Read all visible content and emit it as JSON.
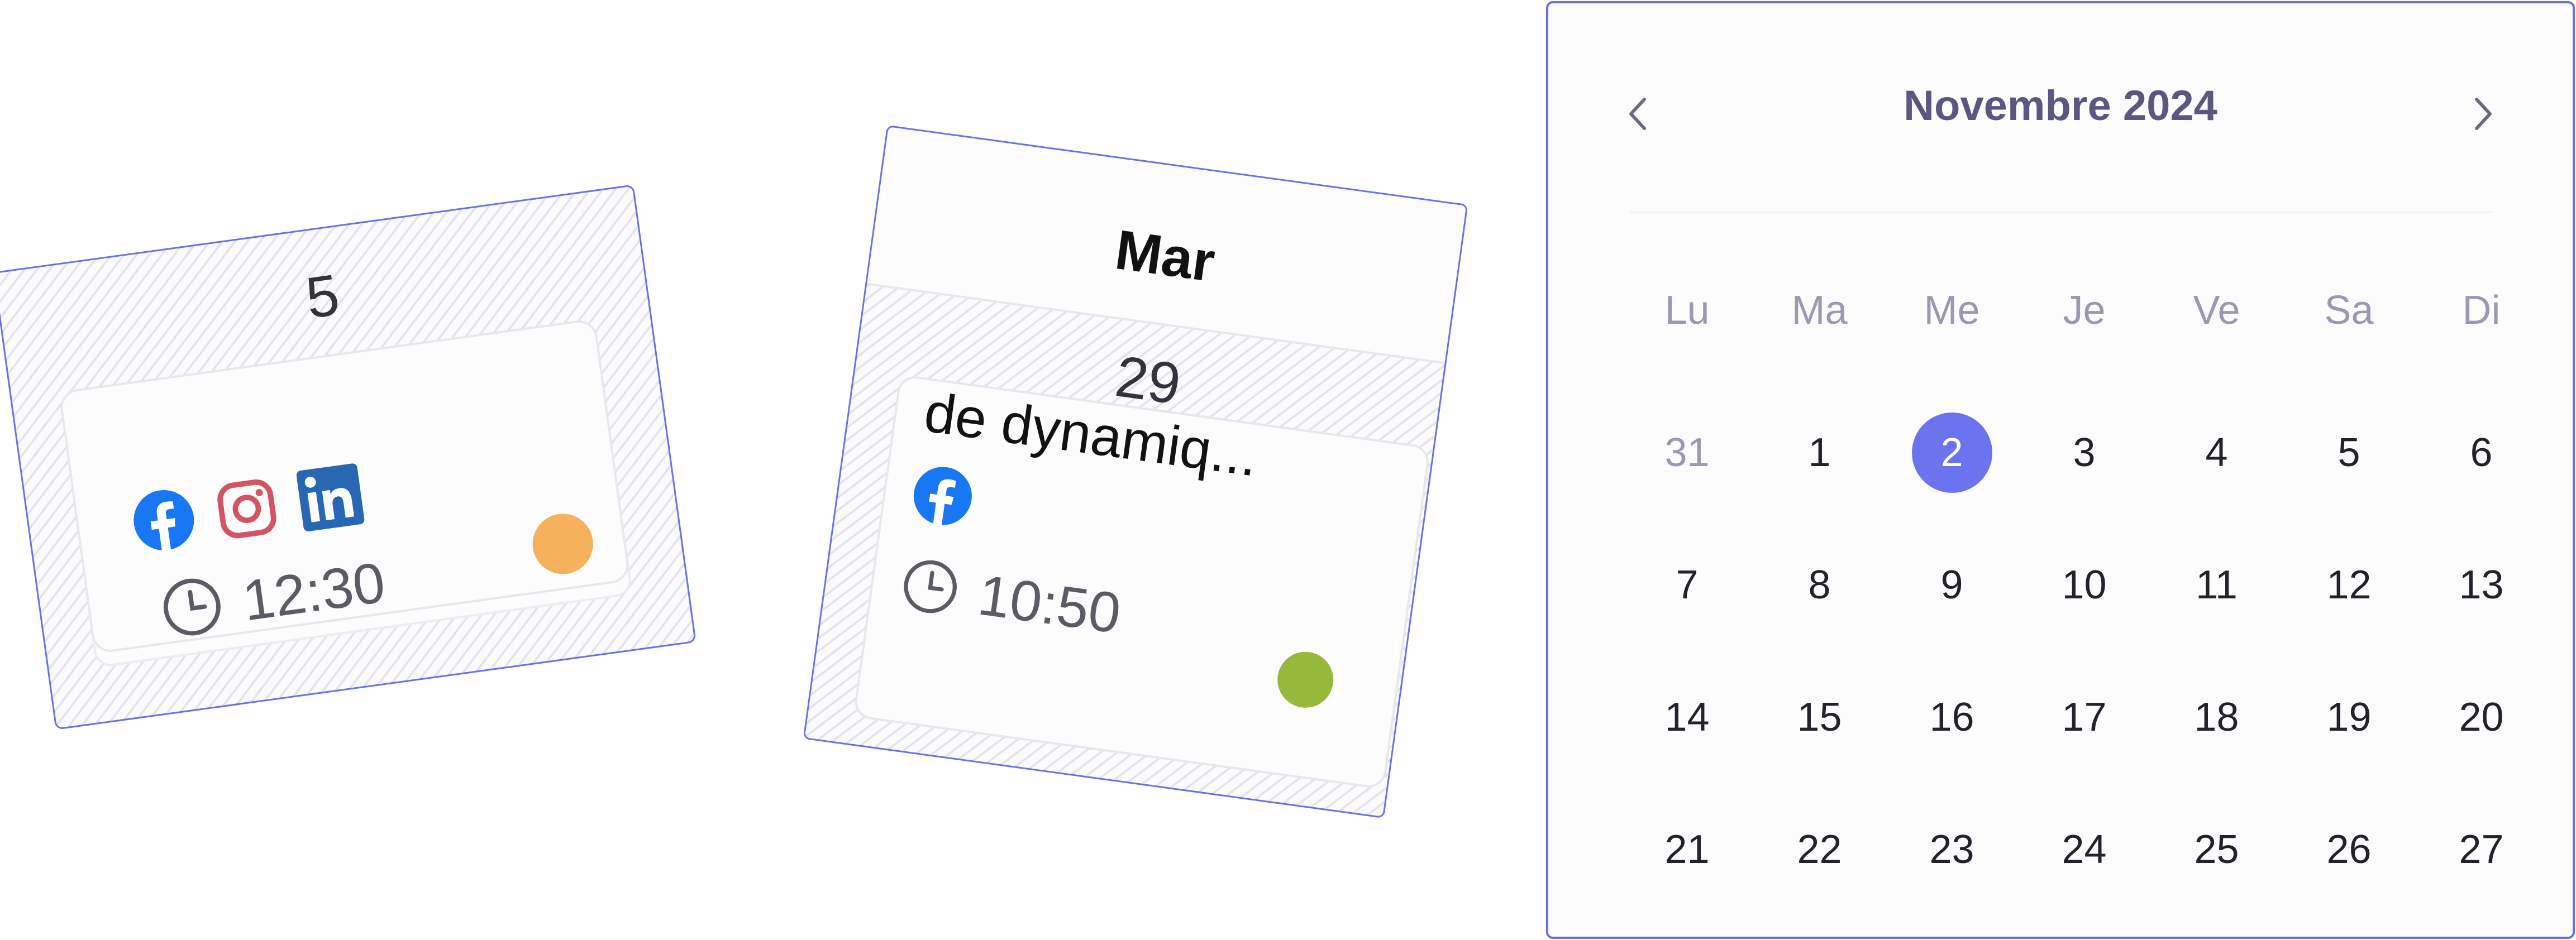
{
  "colors": {
    "accent": "#6670e8",
    "event_dot_orange": "#f6b15c",
    "event_dot_green": "#95ba3b",
    "selected_day": "#6b74ee",
    "facebook": "#1877f2",
    "instagram": "#d55463",
    "linkedin": "#2867b2"
  },
  "week_cell": {
    "day_number": "5",
    "event": {
      "networks": [
        "facebook-icon",
        "instagram-icon",
        "linkedin-icon"
      ],
      "time": "12:30"
    }
  },
  "day_column": {
    "day_name": "Mar",
    "day_number": "29",
    "event": {
      "title": "de dynamiq...",
      "networks": [
        "facebook-icon"
      ],
      "time": "10:50"
    }
  },
  "calendar": {
    "month_label": "Novembre 2024",
    "weekdays": [
      "Lu",
      "Ma",
      "Me",
      "Je",
      "Ve",
      "Sa",
      "Di"
    ],
    "days": [
      {
        "label": "31",
        "muted": true
      },
      {
        "label": "1"
      },
      {
        "label": "2",
        "selected": true
      },
      {
        "label": "3"
      },
      {
        "label": "4"
      },
      {
        "label": "5"
      },
      {
        "label": "6"
      },
      {
        "label": "7"
      },
      {
        "label": "8"
      },
      {
        "label": "9"
      },
      {
        "label": "10"
      },
      {
        "label": "11"
      },
      {
        "label": "12"
      },
      {
        "label": "13"
      },
      {
        "label": "14"
      },
      {
        "label": "15"
      },
      {
        "label": "16"
      },
      {
        "label": "17"
      },
      {
        "label": "18"
      },
      {
        "label": "19"
      },
      {
        "label": "20"
      },
      {
        "label": "21"
      },
      {
        "label": "22"
      },
      {
        "label": "23"
      },
      {
        "label": "24"
      },
      {
        "label": "25"
      },
      {
        "label": "26"
      },
      {
        "label": "27"
      }
    ]
  }
}
